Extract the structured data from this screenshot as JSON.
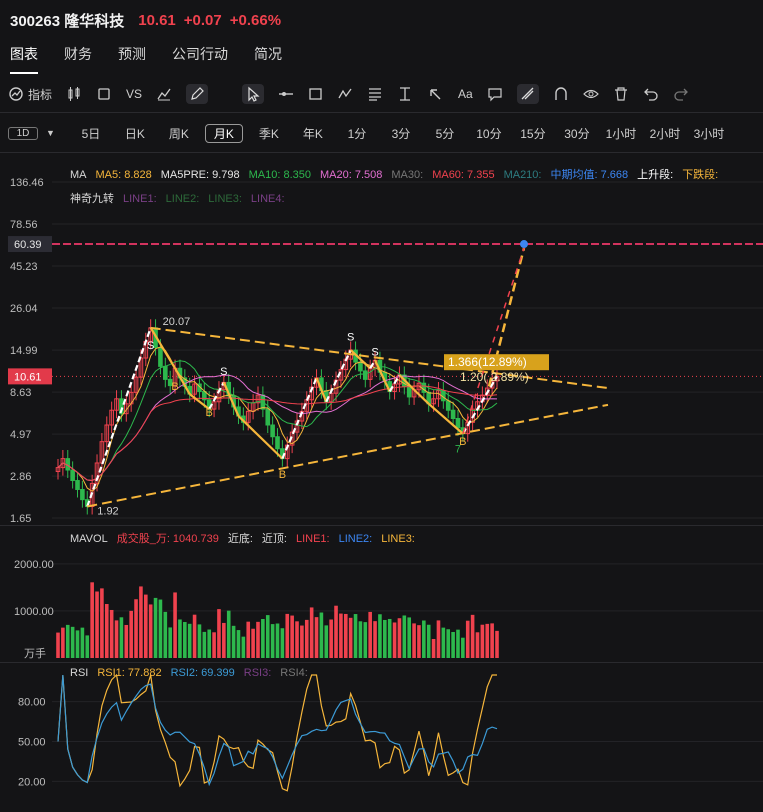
{
  "header": {
    "code_name": "300263 隆华科技",
    "price": "10.61",
    "change": "+0.07",
    "change_pct": "+0.66%"
  },
  "tabs": [
    "图表",
    "财务",
    "预测",
    "公司行动",
    "简况"
  ],
  "toolbar": {
    "indicator_label": "指标",
    "vs_label": "VS",
    "icons": [
      "indicator-icon",
      "candlestick-icon",
      "square-icon",
      "vs-icon",
      "area-chart-icon",
      "pencil-icon",
      "cursor-icon",
      "line-tool-icon",
      "rect-tool-icon",
      "wave-tool-icon",
      "fib-tool-icon",
      "measure-tool-icon",
      "arrow-tool-icon",
      "text-tool-icon",
      "comment-icon",
      "magnet-icon",
      "horseshoe-icon",
      "eye-icon",
      "trash-icon",
      "undo-icon",
      "redo-icon"
    ],
    "text_tool": "Aa"
  },
  "periods": {
    "badge": "1D",
    "items": [
      "5日",
      "日K",
      "周K",
      "月K",
      "季K",
      "年K",
      "1分",
      "3分",
      "5分",
      "10分",
      "15分",
      "30分",
      "1小时",
      "2小时",
      "3小时"
    ],
    "active": "月K"
  },
  "colors": {
    "up": "#f0424e",
    "down": "#2db84d",
    "yellow": "#f6b63b",
    "pink": "#e36fd1",
    "blue": "#3c86f2",
    "white": "#ffffff"
  },
  "price_panel": {
    "legend1": [
      {
        "text": "MA",
        "color": "#d8d8d8"
      },
      {
        "text": "MA5: 8.828",
        "color": "#f6b63b"
      },
      {
        "text": "MA5PRE: 9.798",
        "color": "#e6e6e6"
      },
      {
        "text": "MA10: 8.350",
        "color": "#2db84d"
      },
      {
        "text": "MA20: 7.508",
        "color": "#e36fd1"
      },
      {
        "text": "MA30:",
        "color": "#777777"
      },
      {
        "text": "MA60: 7.355",
        "color": "#f0424e"
      },
      {
        "text": "MA210:",
        "color": "#2d7c80"
      },
      {
        "text": "中期均值: 7.668",
        "color": "#3c86f2"
      },
      {
        "text": "上升段:",
        "color": "#ffffff"
      },
      {
        "text": "下跌段:",
        "color": "#f6b63b"
      }
    ],
    "legend2": [
      {
        "text": "神奇九转",
        "color": "#d8d8d8"
      },
      {
        "text": "LINE1:",
        "color": "#7a3f86"
      },
      {
        "text": "LINE2:",
        "color": "#2d6a3a"
      },
      {
        "text": "LINE3:",
        "color": "#2d6a3a"
      },
      {
        "text": "LINE4:",
        "color": "#7a3f86"
      }
    ],
    "y_ticks": [
      "136.46",
      "78.56",
      "45.23",
      "26.04",
      "14.99",
      "8.63",
      "4.97",
      "2.86",
      "1.65"
    ],
    "y_tick_values": [
      136.46,
      78.56,
      45.23,
      26.04,
      14.99,
      8.63,
      4.97,
      2.86,
      1.65
    ],
    "marker_label": "60.39",
    "marker_value": 60.39,
    "current_label": "10.61",
    "current_value": 10.61,
    "high_label": "20.07",
    "low_label": "1.92",
    "fib_label": "1.366(12.89%)",
    "fib_label2": "1.20( 2.89%)",
    "s_labels": [
      "S",
      "S",
      "S",
      "S"
    ],
    "b_labels": [
      "B",
      "B",
      "B",
      "B"
    ],
    "nine_labels": [
      "7"
    ]
  },
  "vol_panel": {
    "legend": [
      {
        "text": "MAVOL",
        "color": "#d8d8d8"
      },
      {
        "text": "成交股_万: 1040.739",
        "color": "#f0424e"
      },
      {
        "text": "近底:",
        "color": "#d8d8d8"
      },
      {
        "text": "近顶:",
        "color": "#d8d8d8"
      },
      {
        "text": "LINE1:",
        "color": "#f0424e"
      },
      {
        "text": "LINE2:",
        "color": "#3c86f2"
      },
      {
        "text": "LINE3:",
        "color": "#f6b63b"
      }
    ],
    "y_ticks": [
      "2000.00",
      "1000.00",
      "万手"
    ],
    "y_tick_values": [
      2000,
      1000
    ]
  },
  "rsi_panel": {
    "legend": [
      {
        "text": "RSI",
        "color": "#d8d8d8"
      },
      {
        "text": "RSI1: 77.882",
        "color": "#f6b63b"
      },
      {
        "text": "RSI2: 69.399",
        "color": "#3c9bd6"
      },
      {
        "text": "RSI3:",
        "color": "#7a3f86"
      },
      {
        "text": "RSI4:",
        "color": "#777777"
      }
    ],
    "y_ticks": [
      "80.00",
      "50.00",
      "20.00"
    ],
    "y_tick_values": [
      80,
      50,
      20
    ]
  },
  "chart_data": {
    "type": "candlestick",
    "scale": "log",
    "ylim": [
      1.65,
      136.46
    ],
    "close_series": [
      3.2,
      3.6,
      3.1,
      2.7,
      2.4,
      2.1,
      1.92,
      2.6,
      3.4,
      4.5,
      5.6,
      6.8,
      7.9,
      6.5,
      7.4,
      8.6,
      10.5,
      13.5,
      16.8,
      20.07,
      15.5,
      12.1,
      10.2,
      9.4,
      11.8,
      10.4,
      9.3,
      8.4,
      9.6,
      8.7,
      7.8,
      6.9,
      7.6,
      8.9,
      9.8,
      8.2,
      7.1,
      6.3,
      5.8,
      6.7,
      7.5,
      8.3,
      6.9,
      5.6,
      4.8,
      4.1,
      3.6,
      4.3,
      5.1,
      5.9,
      6.7,
      7.8,
      9.2,
      10.4,
      8.8,
      7.6,
      8.5,
      10.1,
      11.6,
      13.3,
      14.99,
      12.8,
      11.4,
      10.2,
      11.8,
      13.1,
      11.2,
      9.9,
      8.7,
      9.6,
      10.8,
      9.3,
      8.1,
      8.9,
      9.7,
      8.6,
      7.4,
      7.9,
      8.8,
      7.7,
      6.8,
      6.1,
      5.4,
      5.0,
      5.8,
      6.9,
      7.6,
      8.3,
      9.1,
      10.0,
      10.61
    ],
    "ma5": 8.828,
    "ma10": 8.35,
    "ma20": 7.508,
    "ma60": 7.355,
    "volume": {
      "unit": "万手",
      "ylim": [
        0,
        2400
      ],
      "last": 1040.739
    },
    "rsi": {
      "rsi1": 77.882,
      "rsi2": 69.399,
      "ylim": [
        0,
        100
      ]
    }
  }
}
